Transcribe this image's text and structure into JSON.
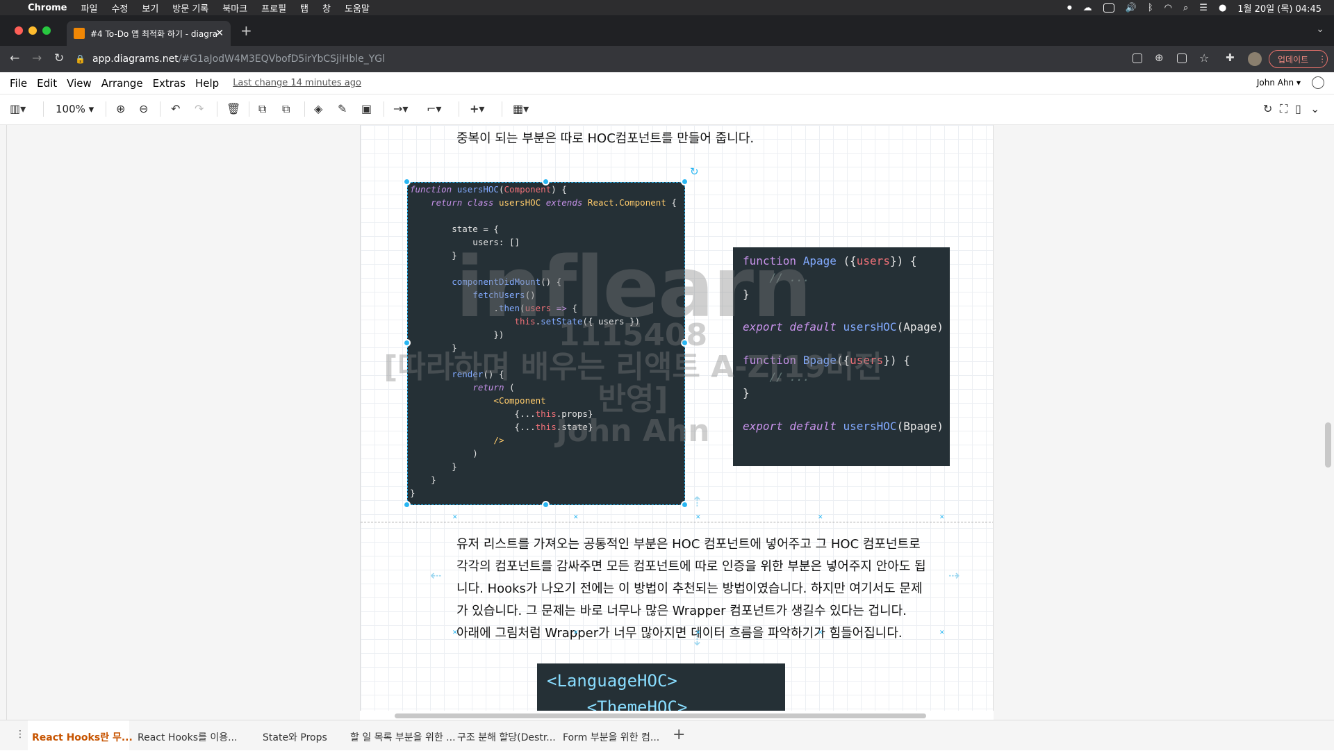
{
  "macbar": {
    "app_name": "Chrome",
    "menus": [
      "파일",
      "수정",
      "보기",
      "방문 기록",
      "북마크",
      "프로필",
      "탭",
      "창",
      "도움말"
    ],
    "datetime": "1월 20일 (목) 04:45"
  },
  "browser": {
    "tab_title": "#4 To-Do 앱 최적화 하기 - diagra",
    "url_host": "app.diagrams.net",
    "url_path": "/#G1aJodW4M3EQVbofD5irYbCSjiHble_YGl",
    "update_button": "업데이트"
  },
  "app": {
    "menus": [
      "File",
      "Edit",
      "View",
      "Arrange",
      "Extras",
      "Help"
    ],
    "last_change": "Last change 14 minutes ago",
    "user": "John Ahn",
    "zoom": "100%"
  },
  "canvas": {
    "heading": "중복이 되는 부분은 따로 HOC컴포넌트를 만들어 줍니다.",
    "paragraph_lines": [
      "유저 리스트를 가져오는 공통적인 부분은 HOC 컴포넌트에 넣어주고 그 HOC 컴포넌트로",
      "각각의 컴포넌트를 감싸주면 모든 컴포넌트에 따로 인증을 위한 부분은 넣어주지 안아도 됩",
      "니다.  Hooks가 나오기 전에는 이 방법이 추천되는 방법이였습니다. 하지만 여기서도 문제",
      "가 있습니다. 그 문제는 바로 너무나 많은 Wrapper 컴포넌트가 생길수 있다는 겁니다.",
      "아래에 그림처럼 Wrapper가 너무 많아지면 데이터 흐름을 파악하기가 힘들어집니다."
    ],
    "code3_lines": [
      "<LanguageHOC>",
      "<ThemeHOC>"
    ],
    "watermark": {
      "logo": "inflearn",
      "number": "1115408",
      "title": "[따라하며 배우는 리액트 A-Z[19버전 반영]",
      "name": "John Ahn"
    }
  },
  "page_tabs": [
    "React Hooks란 무...",
    "React Hooks를 이용...",
    "State와 Props",
    "할 일 목록 부분을 위한 ...",
    "구조 분해 할당(Destr...",
    "Form 부분을 위한 컴..."
  ],
  "colors": {
    "accent": "#29b6f2",
    "code_bg": "#253036",
    "active_tab": "#c75400"
  }
}
